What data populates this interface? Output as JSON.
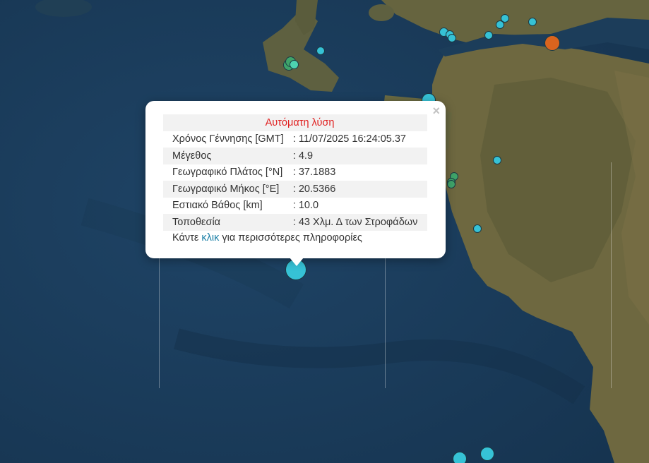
{
  "popup": {
    "title": "Αυτόματη λύση",
    "rows": [
      {
        "label": "Χρόνος Γέννησης [GMT]",
        "value": ": 11/07/2025 16:24:05.37"
      },
      {
        "label": "Μέγεθος",
        "value": ": 4.9"
      },
      {
        "label": "Γεωγραφικό Πλάτος [°N]",
        "value": ": 37.1883"
      },
      {
        "label": "Γεωγραφικό Μήκος [°E]",
        "value": ": 20.5366"
      },
      {
        "label": "Εστιακό Βάθος [km]",
        "value": ": 10.0"
      },
      {
        "label": "Τοποθεσία",
        "value": ": 43 Χλμ. Δ των Στροφάδων"
      }
    ],
    "more_prefix": "Κάντε",
    "more_link": "κλικ",
    "more_suffix": "για περισσότερες πληροφορίες",
    "close_glyph": "×"
  },
  "colors": {
    "sea": "#1d3f5c",
    "land": "#6f6a45",
    "marker_cyan": "#36c2d6",
    "marker_green": "#3fa46a",
    "marker_orange": "#d9641e",
    "title_red": "#e02020",
    "link_blue": "#1a7fa6"
  }
}
